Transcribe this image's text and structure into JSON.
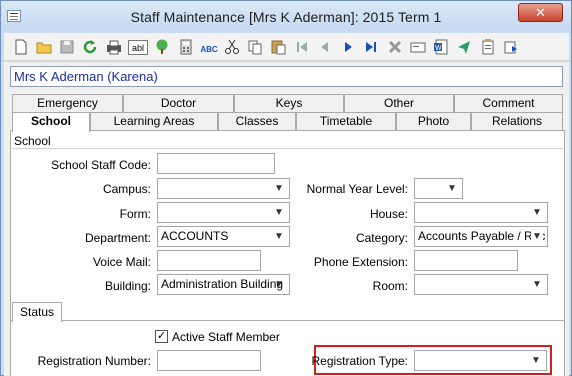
{
  "window": {
    "title": "Staff Maintenance  [Mrs K Aderman]:  2015 Term 1",
    "close_glyph": "✕"
  },
  "toolbar": {
    "icons": [
      "new-document-icon",
      "open-folder-icon",
      "save-icon",
      "refresh-icon",
      "print-icon",
      "abl-icon",
      "tree-icon",
      "calculator-icon",
      "spellcheck-icon",
      "cut-icon",
      "copy-icon",
      "paste-icon",
      "first-record-icon",
      "previous-record-icon",
      "next-record-icon",
      "last-record-icon",
      "delete-icon",
      "card-icon",
      "word-icon",
      "send-icon",
      "clipboard-icon",
      "move-icon"
    ],
    "abl_label": "abl",
    "abc_label": "ABC"
  },
  "name_bar": "Mrs K Aderman (Karena)",
  "tabs_row1": [
    "Emergency",
    "Doctor",
    "Keys",
    "Other",
    "Comment"
  ],
  "tabs_row2": [
    "School",
    "Learning Areas",
    "Classes",
    "Timetable",
    "Photo",
    "Relations"
  ],
  "active_tab": "School",
  "group_label": "School",
  "form": {
    "school_staff_code": {
      "label": "School Staff Code:",
      "value": ""
    },
    "campus": {
      "label": "Campus:",
      "value": ""
    },
    "normal_year_level": {
      "label": "Normal Year Level:",
      "value": ""
    },
    "form": {
      "label": "Form:",
      "value": ""
    },
    "house": {
      "label": "House:",
      "value": ""
    },
    "department": {
      "label": "Department:",
      "value": "ACCOUNTS"
    },
    "category": {
      "label": "Category:",
      "value": "Accounts Payable / Rec"
    },
    "voice_mail": {
      "label": "Voice Mail:",
      "value": ""
    },
    "phone_extension": {
      "label": "Phone Extension:",
      "value": ""
    },
    "building": {
      "label": "Building:",
      "value": "Administration Building"
    },
    "room": {
      "label": "Room:",
      "value": ""
    }
  },
  "status": {
    "tab_label": "Status",
    "active_staff_member": {
      "label": "Active Staff Member",
      "checked": true,
      "glyph": "✓"
    },
    "registration_number": {
      "label": "Registration Number:",
      "value": ""
    },
    "registration_type": {
      "label": "Registration Type:",
      "value": ""
    }
  },
  "colors": {
    "highlight": "#d91b1b",
    "name_text": "#1a2fa0"
  }
}
